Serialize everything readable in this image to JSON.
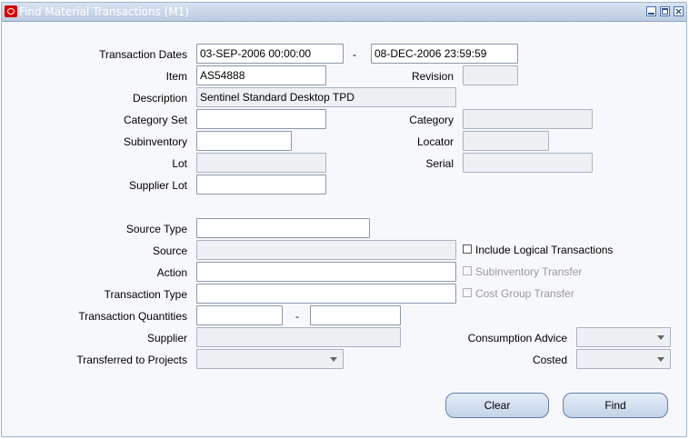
{
  "window": {
    "title": "Find Material Transactions (M1)",
    "close_glyph": "×"
  },
  "form": {
    "transaction_dates": {
      "label": "Transaction Dates",
      "from": "03-SEP-2006 00:00:00",
      "dash": "-",
      "to": "08-DEC-2006 23:59:59"
    },
    "item": {
      "label": "Item",
      "value": "AS54888"
    },
    "revision": {
      "label": "Revision",
      "value": ""
    },
    "description": {
      "label": "Description",
      "value": "Sentinel Standard Desktop TPD"
    },
    "category_set": {
      "label": "Category Set",
      "value": ""
    },
    "category": {
      "label": "Category",
      "value": ""
    },
    "subinventory": {
      "label": "Subinventory",
      "value": ""
    },
    "locator": {
      "label": "Locator",
      "value": ""
    },
    "lot": {
      "label": "Lot",
      "value": ""
    },
    "serial": {
      "label": "Serial",
      "value": ""
    },
    "supplier_lot": {
      "label": "Supplier Lot",
      "value": ""
    },
    "source_type": {
      "label": "Source Type",
      "value": ""
    },
    "source": {
      "label": "Source",
      "value": ""
    },
    "action": {
      "label": "Action",
      "value": ""
    },
    "transaction_type": {
      "label": "Transaction Type",
      "value": ""
    },
    "transaction_quantities": {
      "label": "Transaction Quantities",
      "from": "",
      "dash": "-",
      "to": ""
    },
    "supplier": {
      "label": "Supplier",
      "value": ""
    },
    "transferred_to_projects": {
      "label": "Transferred to Projects",
      "value": ""
    },
    "consumption_advice": {
      "label": "Consumption Advice",
      "value": ""
    },
    "costed": {
      "label": "Costed",
      "value": ""
    }
  },
  "checkboxes": {
    "include_logical": {
      "label": "Include Logical Transactions",
      "checked": false,
      "enabled": true
    },
    "subinventory_transfer": {
      "label": "Subinventory Transfer",
      "checked": false,
      "enabled": false
    },
    "cost_group_transfer": {
      "label": "Cost Group Transfer",
      "checked": false,
      "enabled": false
    }
  },
  "buttons": {
    "clear": "Clear",
    "find": "Find"
  },
  "icons": {
    "app": "oracle-icon",
    "dropdown": "chevron-down-icon"
  }
}
